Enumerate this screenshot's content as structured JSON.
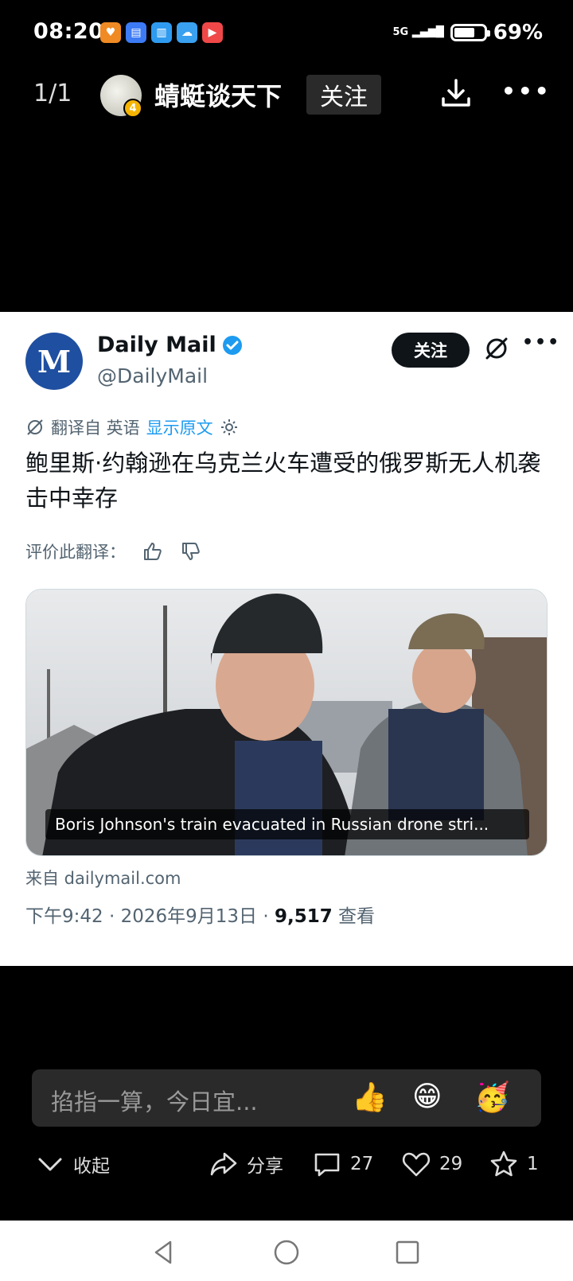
{
  "status": {
    "time": "08:20",
    "signal": "5G",
    "battery": "69%",
    "battery_level": 0.69
  },
  "header": {
    "page_counter": "1/1",
    "author": "蜻蜓谈天下",
    "follow_label": "关注"
  },
  "tweet": {
    "account_name": "Daily Mail",
    "handle": "@DailyMail",
    "logo_text": "M",
    "follow_label": "关注",
    "translated_from": "翻译自 英语",
    "show_original": "显示原文",
    "headline": "鲍里斯·约翰逊在乌克兰火车遭受的俄罗斯无人机袭击中幸存",
    "rate_label": "评价此翻译：",
    "video_caption": "Boris Johnson's train evacuated in Russian drone stri...",
    "source": "来自 dailymail.com",
    "time": "下午9:42 · 2026年9月13日 · ",
    "views": "9,517",
    "views_label": " 查看"
  },
  "comment": {
    "placeholder": "掐指一算，今日宜..."
  },
  "actions": {
    "collapse": "收起",
    "share": "分享",
    "comments": "27",
    "likes": "29",
    "favorites": "1"
  },
  "colors": {
    "brand_blue": "#1f4fa0",
    "verified_blue": "#1d9bf0"
  }
}
